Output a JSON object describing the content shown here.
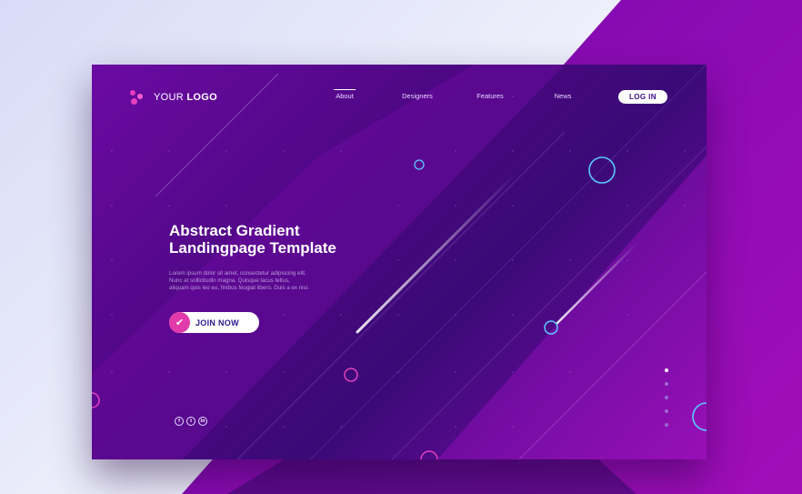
{
  "brand": {
    "logo_prefix": "YOUR",
    "logo_strong": "LOGO"
  },
  "nav": {
    "items": [
      {
        "label": "About",
        "active": true
      },
      {
        "label": "Designers",
        "active": false
      },
      {
        "label": "Features",
        "active": false
      },
      {
        "label": "News",
        "active": false
      }
    ],
    "login_label": "LOG IN"
  },
  "hero": {
    "title_line1": "Abstract Gradient",
    "title_line2": "Landingpage Template",
    "body_line1": "Lorem ipsum dolor sit amet, consectetur adipiscing elit.",
    "body_line2": "Nunc at sollicitudin magna. Quisque lacus tellus,",
    "body_line3": "aliquam quis leo eu, finibus feugiat libero. Duis a ex nisl.",
    "cta_label": "JOIN NOW"
  },
  "social": [
    {
      "icon": "facebook-icon",
      "glyph": "f"
    },
    {
      "icon": "twitter-icon",
      "glyph": "t"
    },
    {
      "icon": "linkedin-icon",
      "glyph": "in"
    }
  ],
  "pager": {
    "count": 5,
    "active_index": 0
  },
  "colors": {
    "accent_pink": "#e23aaa",
    "ring_blue": "#5cc8ff",
    "ring_pink": "#e040c0",
    "bg_purple": "#4a0780"
  }
}
